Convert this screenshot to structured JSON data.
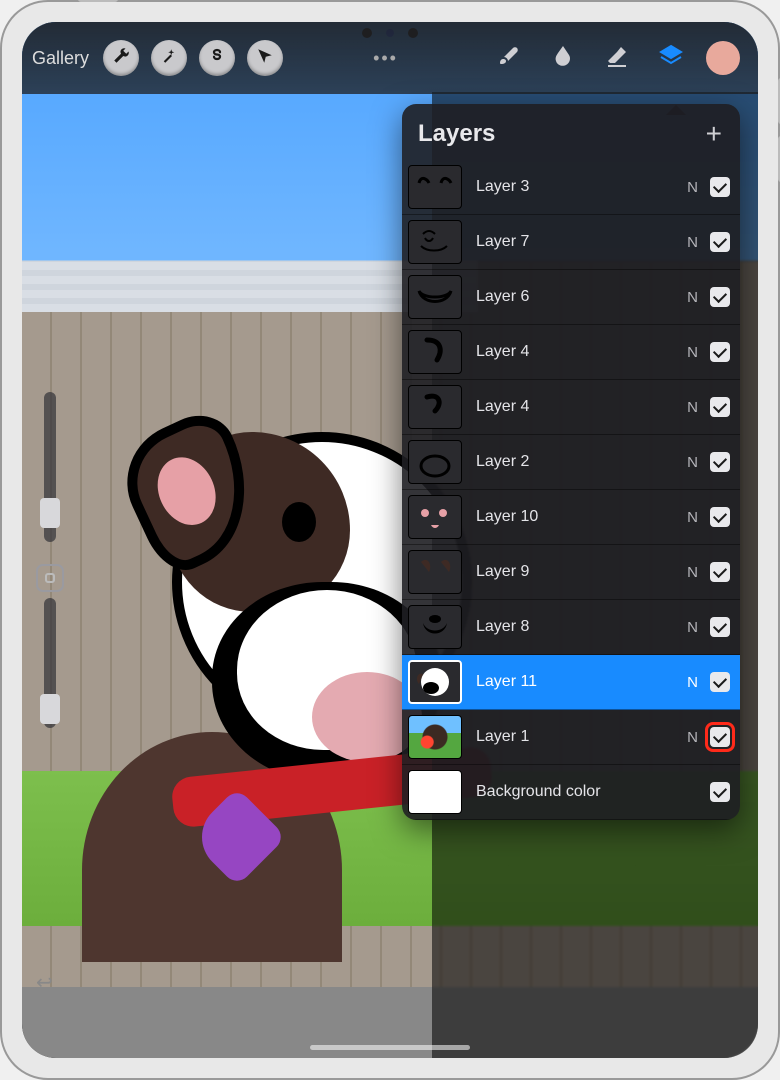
{
  "topbar": {
    "gallery_label": "Gallery",
    "more_label": "•••"
  },
  "colors": {
    "accent": "#188bff",
    "swatch": "#e8a99c",
    "highlight": "#ff2a1a"
  },
  "panel": {
    "title": "Layers"
  },
  "layers": [
    {
      "name": "Layer 3",
      "blend": "N",
      "visible": true,
      "selected": false,
      "thumb": "ears"
    },
    {
      "name": "Layer 7",
      "blend": "N",
      "visible": true,
      "selected": false,
      "thumb": "face-detail"
    },
    {
      "name": "Layer 6",
      "blend": "N",
      "visible": true,
      "selected": false,
      "thumb": "muzzle-outline"
    },
    {
      "name": "Layer 4",
      "blend": "N",
      "visible": true,
      "selected": false,
      "thumb": "curve1"
    },
    {
      "name": "Layer 4",
      "blend": "N",
      "visible": true,
      "selected": false,
      "thumb": "curve2"
    },
    {
      "name": "Layer 2",
      "blend": "N",
      "visible": true,
      "selected": false,
      "thumb": "circle"
    },
    {
      "name": "Layer 10",
      "blend": "N",
      "visible": true,
      "selected": false,
      "thumb": "pink-spots"
    },
    {
      "name": "Layer 9",
      "blend": "N",
      "visible": true,
      "selected": false,
      "thumb": "brown-shapes"
    },
    {
      "name": "Layer 8",
      "blend": "N",
      "visible": true,
      "selected": false,
      "thumb": "mouth"
    },
    {
      "name": "Layer 11",
      "blend": "N",
      "visible": true,
      "selected": true,
      "thumb": "dogshape"
    },
    {
      "name": "Layer 1",
      "blend": "N",
      "visible": true,
      "selected": false,
      "thumb": "photo",
      "highlight": true
    },
    {
      "name": "Background color",
      "blend": "",
      "visible": true,
      "selected": false,
      "thumb": "bgwhite"
    }
  ]
}
